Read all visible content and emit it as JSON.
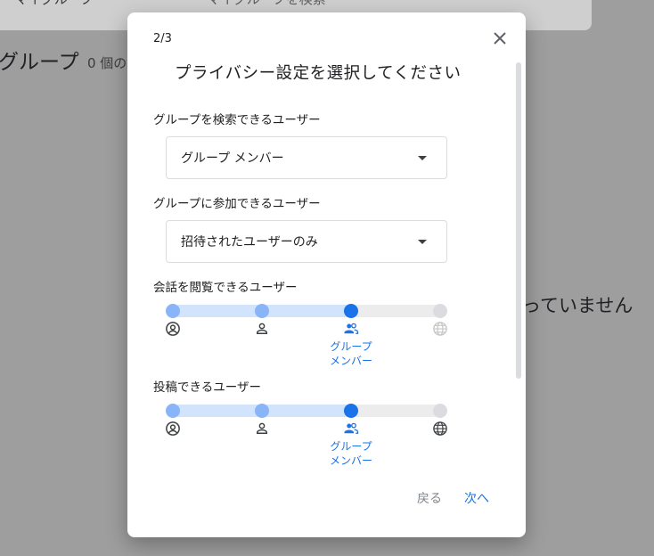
{
  "background": {
    "filter_label": "マイグループ",
    "search_placeholder": "マイグループを検索",
    "page_title": "グループ",
    "count_text": "0 個の",
    "empty_text": "っていません"
  },
  "dialog": {
    "step": "2/3",
    "title": "プライバシー設定を選択してください",
    "find_label": "グループを検索できるユーザー",
    "find_value": "グループ メンバー",
    "join_label": "グループに参加できるユーザー",
    "join_value": "招待されたユーザーのみ",
    "view_label": "会話を閲覧できるユーザー",
    "view_selected_label": "グループ\nメンバー",
    "post_label": "投稿できるユーザー",
    "post_selected_label": "グループ\nメンバー",
    "back_button": "戻る",
    "next_button": "次へ"
  },
  "sliders": {
    "view": {
      "selected_index": 2,
      "last_disabled": true,
      "icons": [
        "account-circle-icon",
        "person-icon",
        "people-icon",
        "globe-icon"
      ]
    },
    "post": {
      "selected_index": 2,
      "last_disabled": false,
      "icons": [
        "account-circle-icon",
        "person-icon",
        "people-icon",
        "globe-icon"
      ]
    }
  },
  "colors": {
    "accent": "#1a73e8",
    "track_fill": "#d2e3fc",
    "inactive_dot": "#8ab4f8",
    "disabled": "#dadce0",
    "scrim": "#9e9e9e"
  }
}
